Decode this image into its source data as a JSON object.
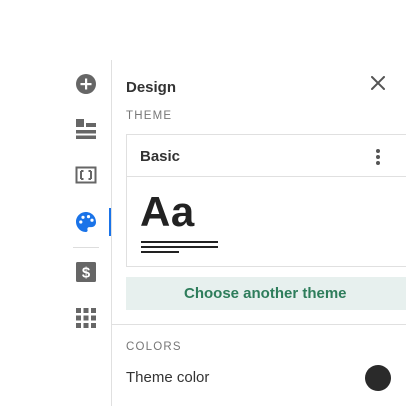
{
  "sidebar": {
    "items": [
      {
        "name": "add",
        "icon": "add-circle-icon",
        "active": false
      },
      {
        "name": "layout",
        "icon": "layout-icon",
        "active": false
      },
      {
        "name": "media",
        "icon": "media-frame-icon",
        "active": false
      },
      {
        "name": "design",
        "icon": "palette-icon",
        "active": true
      },
      {
        "name": "pricing",
        "icon": "dollar-icon",
        "active": false
      },
      {
        "name": "apps",
        "icon": "apps-grid-icon",
        "active": false
      }
    ],
    "icon_color": "#666666",
    "active_color": "#1a73e8"
  },
  "panel": {
    "title": "Design",
    "theme_section_label": "THEME",
    "theme": {
      "name": "Basic",
      "sample_text": "Aa"
    },
    "choose_button_label": "Choose another theme",
    "colors_section_label": "COLORS",
    "theme_color_label": "Theme color",
    "theme_color_value": "#2a2a2a"
  },
  "colors": {
    "button_bg": "#e7f0ee",
    "button_text": "#2e7d5b"
  }
}
